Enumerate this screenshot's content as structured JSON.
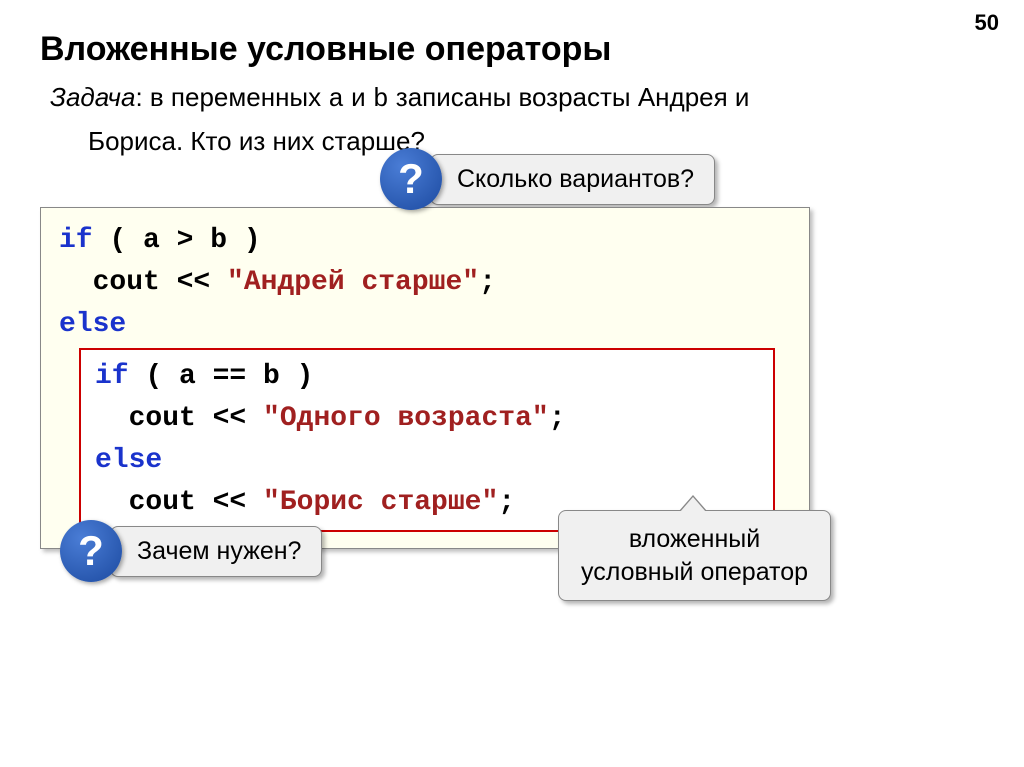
{
  "page_number": "50",
  "heading": "Вложенные условные операторы",
  "problem": {
    "label": "Задача",
    "line1_before_a": ": в переменных ",
    "var_a": "a",
    "between": " и ",
    "var_b": "b",
    "line1_after_b": " записаны возрасты Андрея и",
    "line2": "Бориса. Кто из них старше?"
  },
  "callout1": {
    "q": "?",
    "text": "Сколько вариантов?"
  },
  "code": {
    "l1": "if ( a > b )",
    "l2_pre": "  cout << ",
    "l2_str": "\"Андрей старше\"",
    "l2_post": ";",
    "l3": "else",
    "inner": {
      "l1": "if ( a == b )",
      "l2_pre": "  cout << ",
      "l2_str": "\"Одного возраста\"",
      "l2_post": ";",
      "l3": "else",
      "l4_pre": "  cout << ",
      "l4_str": "\"Борис старше\"",
      "l4_post": ";"
    }
  },
  "callout2": {
    "q": "?",
    "text": "Зачем нужен?"
  },
  "callout3": {
    "line1": "вложенный",
    "line2": "условный оператор"
  }
}
